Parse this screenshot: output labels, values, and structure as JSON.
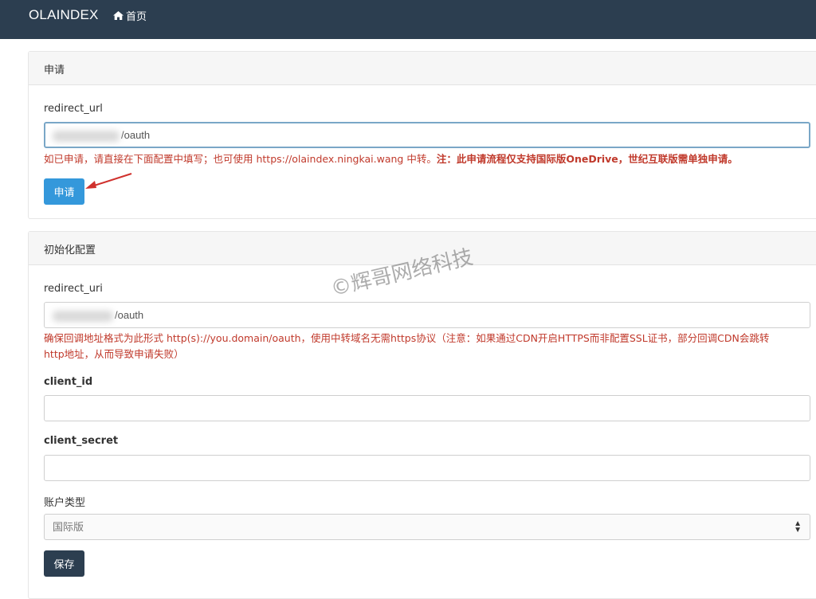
{
  "navbar": {
    "brand": "OLAINDEX",
    "home_label": "首页",
    "home_icon": "home-icon"
  },
  "apply_panel": {
    "title": "申请",
    "redirect_label": "redirect_url",
    "redirect_value": "/oauth",
    "help_normal": "如已申请，请直接在下面配置中填写；也可使用 https://olaindex.ningkai.wang 中转。",
    "help_bold": "注：此申请流程仅支持国际版OneDrive，世纪互联版需单独申请。",
    "apply_button": "申请"
  },
  "config_panel": {
    "title": "初始化配置",
    "redirect_label": "redirect_uri",
    "redirect_value": "/oauth",
    "redirect_help_line1": "确保回调地址格式为此形式 http(s)://you.domain/oauth，使用中转域名无需https协议（注意：如果通过CDN开启HTTPS而非配置SSL证书，部分回调CDN会跳转",
    "redirect_help_line2": "http地址，从而导致申请失败）",
    "client_id_label": "client_id",
    "client_id_value": "",
    "client_secret_label": "client_secret",
    "client_secret_value": "",
    "account_type_label": "账户类型",
    "account_type_selected": "国际版",
    "save_button": "保存"
  },
  "watermark": "©辉哥网络科技",
  "colors": {
    "navbar_bg": "#2c3e50",
    "primary": "#3498db",
    "danger_text": "#c0392b",
    "dark_button": "#2c3e50"
  }
}
